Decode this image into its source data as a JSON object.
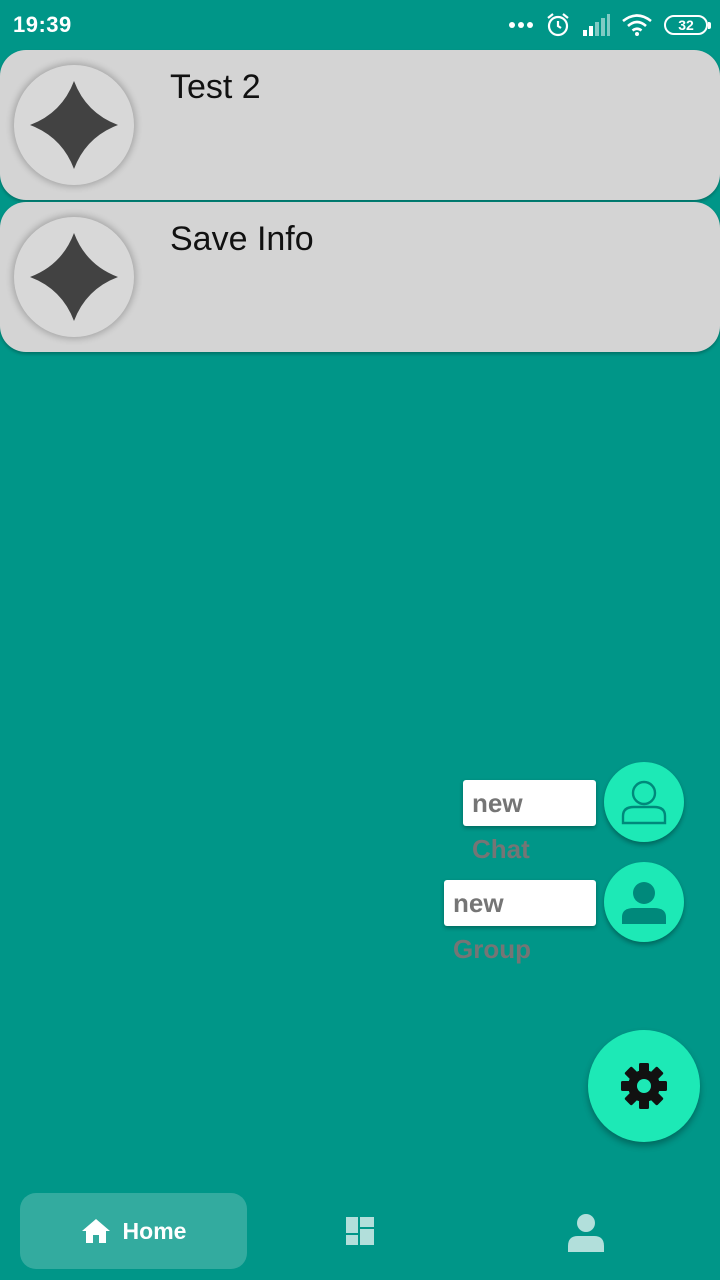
{
  "status_bar": {
    "time": "19:39",
    "battery": "32",
    "icons": [
      "more-dots-icon",
      "alarm-icon",
      "signal-icon",
      "wifi-icon",
      "battery-icon"
    ]
  },
  "chats": [
    {
      "title": "Test 2",
      "avatar_icon": "app-diamond-icon"
    },
    {
      "title": "Save Info",
      "avatar_icon": "app-diamond-icon"
    }
  ],
  "fab_menu": {
    "new_chat_label": "new Chat",
    "new_group_label": "new Group",
    "new_chat_icon": "person-outline-icon",
    "new_group_icon": "person-filled-icon",
    "settings_icon": "gear-icon"
  },
  "bottom_nav": {
    "home_label": "Home",
    "items": [
      "home-icon",
      "dashboard-icon",
      "profile-icon"
    ]
  },
  "colors": {
    "background": "#009688",
    "card": "#d4d4d4",
    "accent": "#1de9b6",
    "avatar_mark": "#424242"
  }
}
